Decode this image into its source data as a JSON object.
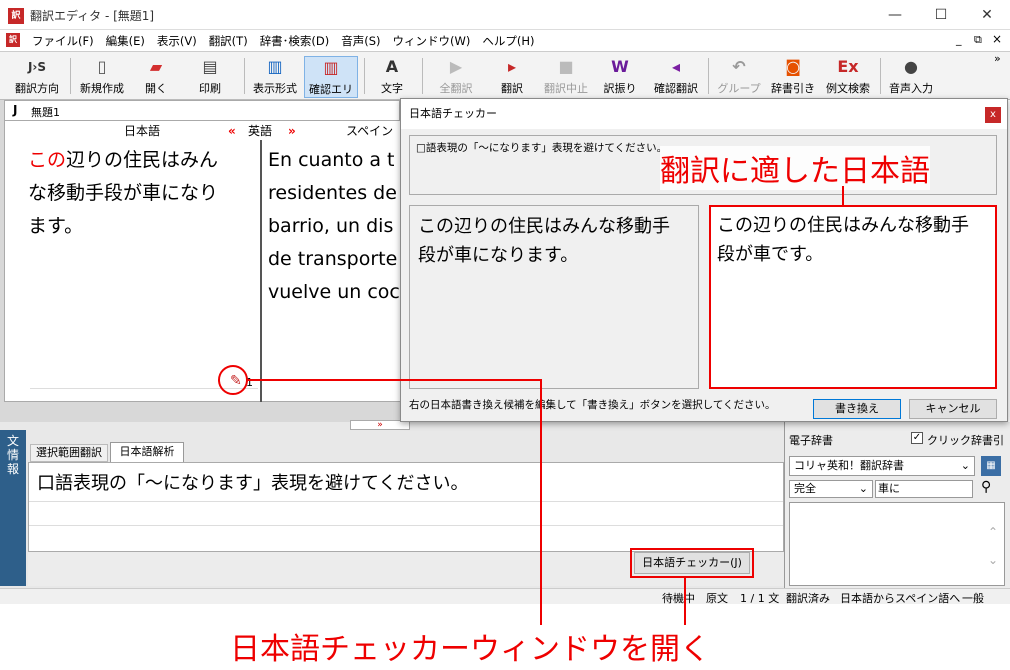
{
  "window": {
    "title": "翻訳エディタ - [無題1]",
    "minimize": "—",
    "maximize": "☐",
    "close": "✕"
  },
  "menu": [
    "ファイル(F)",
    "編集(E)",
    "表示(V)",
    "翻訳(T)",
    "辞書･検索(D)",
    "音声(S)",
    "ウィンドウ(W)",
    "ヘルプ(H)"
  ],
  "menu_right": {
    "min": "_",
    "restore": "⧉",
    "close": "×"
  },
  "toolbar": {
    "direction": "翻訳方向",
    "new": "新規作成",
    "open": "開く",
    "print": "印刷",
    "display": "表示形式",
    "check_area": "確認エリア",
    "text": "文字",
    "translate_all": "全翻訳",
    "translate": "翻訳",
    "stop": "翻訳中止",
    "assign": "訳振り",
    "confirm": "確認翻訳",
    "group": "グループ",
    "dict_lookup": "辞書引き",
    "example_search": "例文検索",
    "voice": "音声入力",
    "more": "»"
  },
  "doc_tab": {
    "mark": "J",
    "label": "無題1"
  },
  "columns": {
    "japanese": "日本語",
    "english": "英語",
    "spanish": "スペイン",
    "arrow_left": "«",
    "arrow_right": "»"
  },
  "source_text": {
    "highlight": "この",
    "rest_line1": "辺りの住民はみん",
    "line2": "な移動手段が車になり",
    "line3": "ます。"
  },
  "target_text": [
    "En cuanto a t",
    "residentes de",
    "barrio, un dis",
    "de transporte",
    "vuelve un coc"
  ],
  "marker_count": "1",
  "bottom": {
    "side_label": [
      "文",
      "情",
      "報"
    ],
    "tab_select": "選択範囲翻訳",
    "tab_analysis": "日本語解析",
    "message": "口語表現の「〜になります」表現を避けてください。",
    "checker_button": "日本語チェッカー(J)",
    "collapse": "»"
  },
  "dictionary": {
    "title": "電子辞書",
    "click_lookup": "クリック辞書引",
    "dict_name": "コリャ英和！翻訳辞書",
    "mode": "完全",
    "query": "車に"
  },
  "status": [
    "待機中",
    "原文",
    "1 / 1 文",
    "翻訳済み",
    "日本語からスペイン語へ",
    "一般"
  ],
  "dialog": {
    "title": "日本語チェッカー",
    "close": "x",
    "issue": "□語表現の「〜になります」表現を避けてください。",
    "original": "この辺りの住民はみんな移動手段が車になります。",
    "suggestion": "この辺りの住民はみんな移動手段が車です。",
    "hint": "右の日本語書き換え候補を編集して「書き換え」ボタンを選択してください。",
    "replace": "書き換え",
    "cancel": "キャンセル"
  },
  "annotations": {
    "suggestion_label": "翻訳に適した日本語",
    "open_label": "日本語チェッカーウィンドウを開く",
    "color": "#e00000"
  }
}
